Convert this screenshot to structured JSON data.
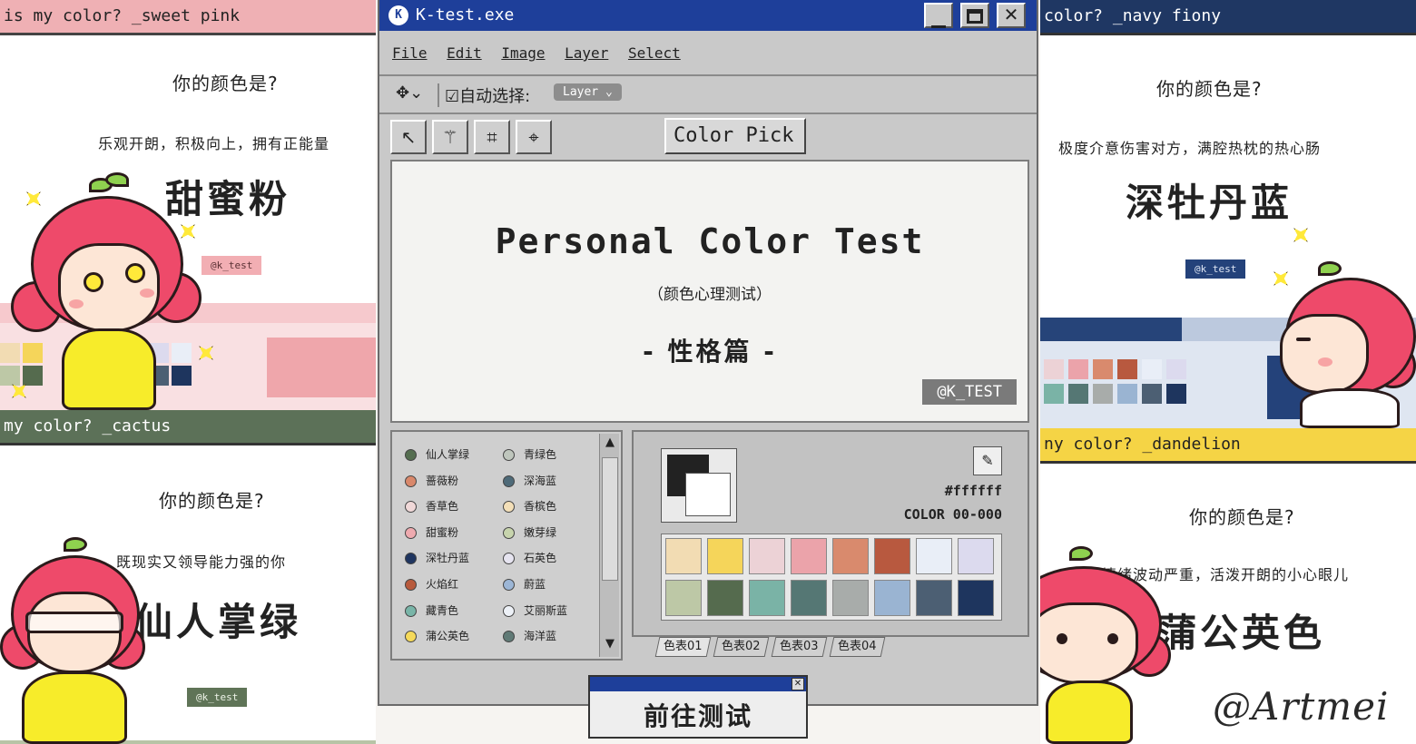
{
  "panels": {
    "sweet_pink": {
      "bar": "is my color? _sweet pink",
      "question": "你的颜色是?",
      "desc": "乐观开朗，积极向上，拥有正能量",
      "name": "甜蜜粉",
      "tag": "@k_test"
    },
    "cactus": {
      "bar": "my color? _cactus",
      "question": "你的颜色是?",
      "desc": "既现实又领导能力强的你",
      "name": "仙人掌绿",
      "tag": "@k_test"
    },
    "navy_fiony": {
      "bar": "color? _navy fiony",
      "question": "你的颜色是?",
      "desc": "极度介意伤害对方，满腔热枕的热心肠",
      "name": "深牡丹蓝",
      "tag": "@k_test"
    },
    "dandelion": {
      "bar": "ny color? _dandelion",
      "question": "你的颜色是?",
      "desc": "情绪波动严重，活泼开朗的小心眼儿",
      "name": "蒲公英色"
    },
    "watermark": "@Artmei"
  },
  "window": {
    "title": "K-test.exe",
    "app_icon": "K",
    "controls": [
      "minimize-icon",
      "maximize-icon",
      "close-icon"
    ],
    "menu": [
      "File",
      "Edit",
      "Image",
      "Layer",
      "Select"
    ],
    "options": {
      "auto_select_label": "☑自动选择:",
      "layer_select": "Layer ⌄",
      "move_icon": "✥⌄"
    },
    "tools": [
      "arrow-icon",
      "magic-wand-icon",
      "crop-icon",
      "crosshair-icon"
    ],
    "color_pick_label": "Color Pick ☑",
    "canvas": {
      "title": "Personal Color Test",
      "subtitle": "（颜色心理测试）",
      "section": "- 性格篇 -",
      "tag": "@K_TEST"
    },
    "color_list": [
      {
        "name": "仙人掌绿",
        "color": "#556e50"
      },
      {
        "name": "青绿色",
        "color": "#bfc6bd"
      },
      {
        "name": "蔷薇粉",
        "color": "#d9886b"
      },
      {
        "name": "深海蓝",
        "color": "#4e6a78"
      },
      {
        "name": "香草色",
        "color": "#f0d8d8"
      },
      {
        "name": "香槟色",
        "color": "#f3dfb8"
      },
      {
        "name": "甜蜜粉",
        "color": "#eeaaaf"
      },
      {
        "name": "嫩芽绿",
        "color": "#c7d4ad"
      },
      {
        "name": "深牡丹蓝",
        "color": "#1f3560"
      },
      {
        "name": "石英色",
        "color": "#e6e4f0"
      },
      {
        "name": "火焰红",
        "color": "#b85a3c"
      },
      {
        "name": "蔚蓝",
        "color": "#9cb6d6"
      },
      {
        "name": "藏青色",
        "color": "#79b5a8"
      },
      {
        "name": "艾丽斯蓝",
        "color": "#edf1f7"
      },
      {
        "name": "蒲公英色",
        "color": "#f5d95a"
      },
      {
        "name": "海洋蓝",
        "color": "#607a76"
      }
    ],
    "picker": {
      "hex": "#ffffff",
      "code": "COLOR 00-000",
      "eyedropper": "eyedropper-icon",
      "swatches": [
        "#f2dcb3",
        "#f5d55a",
        "#ecd2d6",
        "#eba3aa",
        "#d98a6d",
        "#b8593f",
        "#e9eef7",
        "#dcdaee",
        "#bdc8a6",
        "#556b4e",
        "#7ab3a6",
        "#557774",
        "#a8acaa",
        "#9ab4d2",
        "#4c5f73",
        "#1e355e"
      ],
      "tabs": [
        "色表01",
        "色表02",
        "色表03",
        "色表04"
      ]
    },
    "dialog": {
      "button": "前往测试"
    }
  }
}
